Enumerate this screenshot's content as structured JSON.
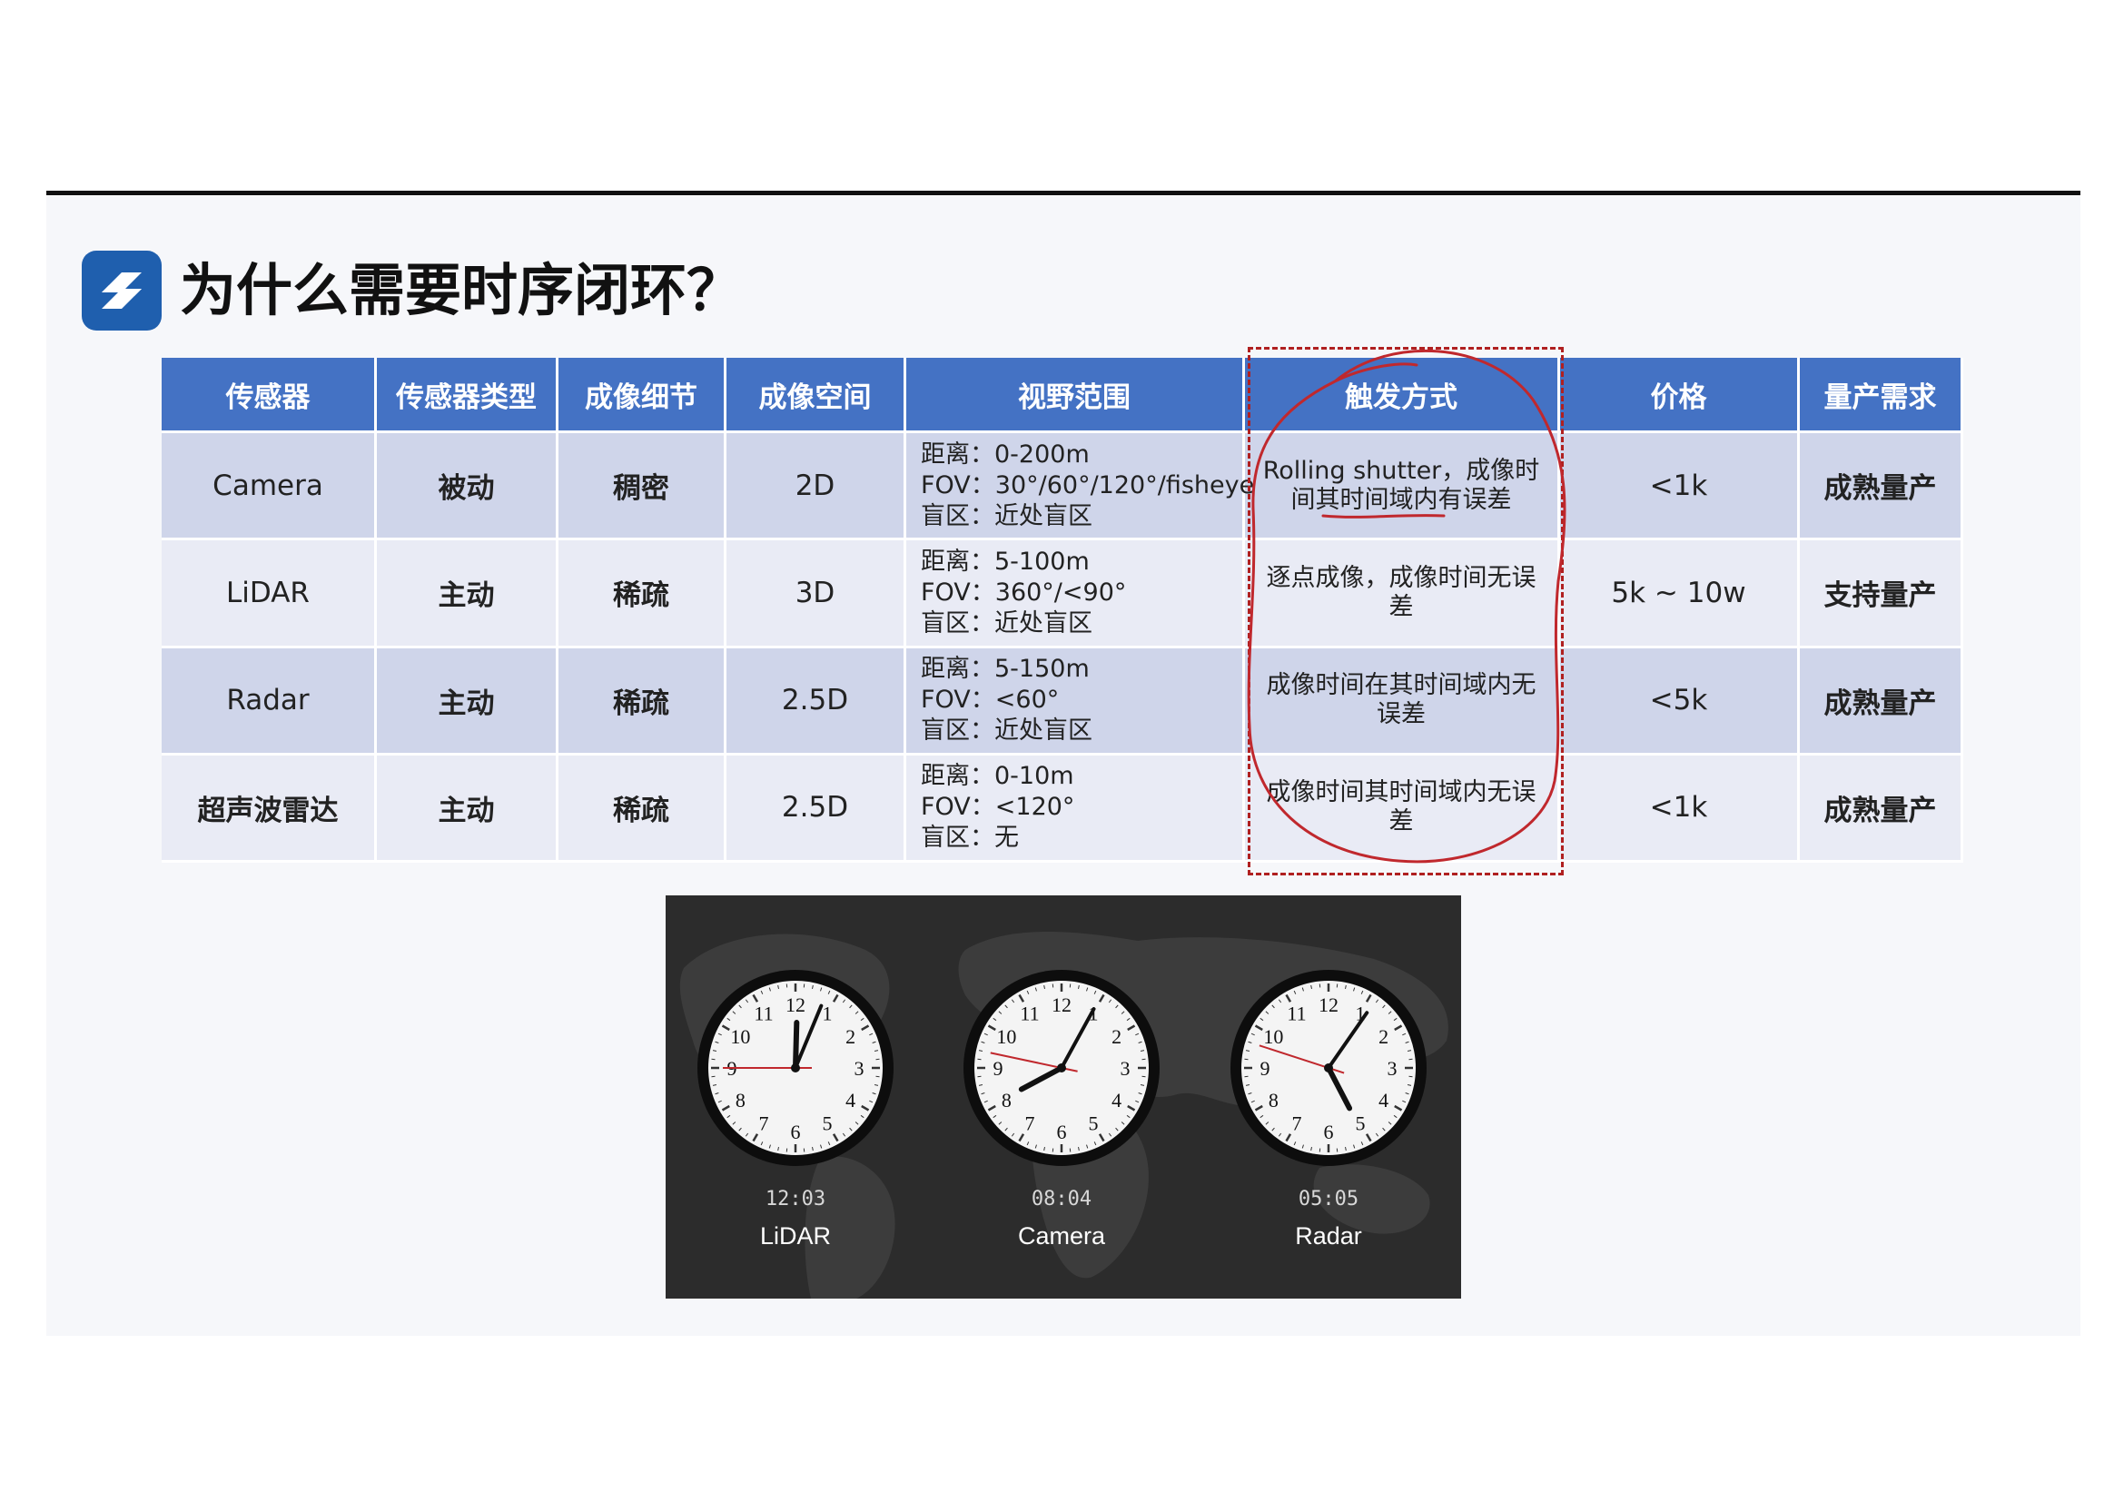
{
  "title": "为什么需要时序闭环？",
  "table": {
    "headers": [
      "传感器",
      "传感器类型",
      "成像细节",
      "成像空间",
      "视野范围",
      "触发方式",
      "价格",
      "量产需求"
    ],
    "rows": [
      {
        "sensor": "Camera",
        "type": "被动",
        "detail": "稠密",
        "space": "2D",
        "view": [
          "距离：0-200m",
          "FOV：30°/60°/120°/fisheye",
          "盲区：近处盲区"
        ],
        "trigger": "Rolling shutter，成像时间其时间域内有误差",
        "price": "<1k",
        "production": "成熟量产"
      },
      {
        "sensor": "LiDAR",
        "type": "主动",
        "detail": "稀疏",
        "space": "3D",
        "view": [
          "距离：5-100m",
          "FOV：360°/<90°",
          "盲区：近处盲区"
        ],
        "trigger": "逐点成像，成像时间无误差",
        "price": "5k ~ 10w",
        "production": "支持量产"
      },
      {
        "sensor": "Radar",
        "type": "主动",
        "detail": "稀疏",
        "space": "2.5D",
        "view": [
          "距离：5-150m",
          "FOV：<60°",
          "盲区：近处盲区"
        ],
        "trigger": "成像时间在其时间域内无误差",
        "price": "<5k",
        "production": "成熟量产"
      },
      {
        "sensor": "超声波雷达",
        "type": "主动",
        "detail": "稀疏",
        "space": "2.5D",
        "view": [
          "距离：0-10m",
          "FOV：<120°",
          "盲区：无"
        ],
        "trigger": "成像时间其时间域内无误差",
        "price": "<1k",
        "production": "成熟量产"
      }
    ]
  },
  "clocks": [
    {
      "time": "12:03",
      "name": "LiDAR",
      "hour": 12,
      "minute": 3,
      "second": 45
    },
    {
      "time": "08:04",
      "name": "Camera",
      "hour": 8,
      "minute": 4,
      "second": 47
    },
    {
      "time": "05:05",
      "name": "Radar",
      "hour": 5,
      "minute": 5,
      "second": 48
    }
  ],
  "colors": {
    "header_bg": "#4472c4",
    "row_odd": "#cfd5ea",
    "row_even": "#e9ebf5",
    "annotation": "#b02020",
    "logo": "#1f5fae"
  }
}
